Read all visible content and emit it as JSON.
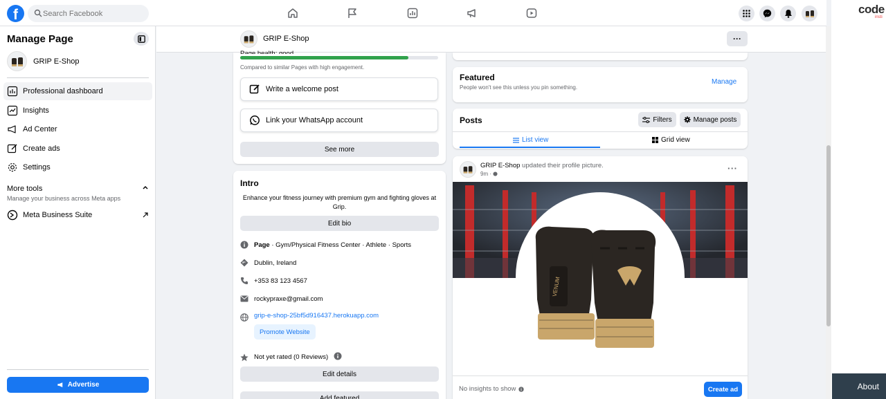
{
  "topbar": {
    "logo": "f",
    "search_placeholder": "Search Facebook",
    "nav_icons": [
      "home-icon",
      "flag-icon",
      "chart-icon",
      "megaphone-icon",
      "video-icon"
    ],
    "right_icons": [
      "menu-grid-icon",
      "messenger-icon",
      "bell-icon",
      "profile-avatar"
    ]
  },
  "external": {
    "logo_text": "code",
    "logo_sub": "insti",
    "about_label": "About"
  },
  "sidebar": {
    "title": "Manage Page",
    "page_name": "GRIP E-Shop",
    "items": [
      {
        "label": "Professional dashboard",
        "icon": "dashboard-icon"
      },
      {
        "label": "Insights",
        "icon": "insights-icon"
      },
      {
        "label": "Ad Center",
        "icon": "megaphone-icon"
      },
      {
        "label": "Create ads",
        "icon": "pencil-icon"
      },
      {
        "label": "Settings",
        "icon": "gear-icon"
      }
    ],
    "more_tools_title": "More tools",
    "more_tools_sub": "Manage your business across Meta apps",
    "meta_suite_label": "Meta Business Suite",
    "advertise_label": "Advertise"
  },
  "page_header": {
    "name": "GRIP E-Shop",
    "more_label": "···"
  },
  "left_column": {
    "health_label": "Page health: good",
    "health_progress": 0.85,
    "health_color": "#31a24c",
    "health_sub": "Compared to similar Pages with high engagement.",
    "welcome_post_label": "Write a welcome post",
    "whatsapp_label": "Link your WhatsApp account",
    "see_more_label": "See more",
    "intro": {
      "title": "Intro",
      "bio": "Enhance your fitness journey with premium gym and fighting gloves at Grip.",
      "edit_bio_label": "Edit bio",
      "category_bold": "Page",
      "category_rest": " · Gym/Physical Fitness Center · Athlete · Sports",
      "location": "Dublin, Ireland",
      "phone": "+353 83 123 4567",
      "email": "rockypraxe@gmail.com",
      "website": "grip-e-shop-25bf5d916437.herokuapp.com",
      "promote_label": "Promote Website",
      "rating": "Not yet rated (0 Reviews)",
      "edit_details_label": "Edit details",
      "add_featured_label": "Add featured"
    }
  },
  "right_column": {
    "featured_title": "Featured",
    "featured_sub": "People won't see this unless you pin something.",
    "featured_manage": "Manage",
    "posts_title": "Posts",
    "filters_label": "Filters",
    "manage_posts_label": "Manage posts",
    "list_view_label": "List view",
    "grid_view_label": "Grid view",
    "post": {
      "author": "GRIP E-Shop",
      "action": " updated their profile picture.",
      "time": "9m ·",
      "image_brand": "VENUM",
      "no_insights": "No insights to show",
      "create_ad_label": "Create ad"
    }
  },
  "colors": {
    "accent": "#1877f2",
    "page_bg": "#f0f2f5",
    "ring_red": "#c22b2b"
  }
}
